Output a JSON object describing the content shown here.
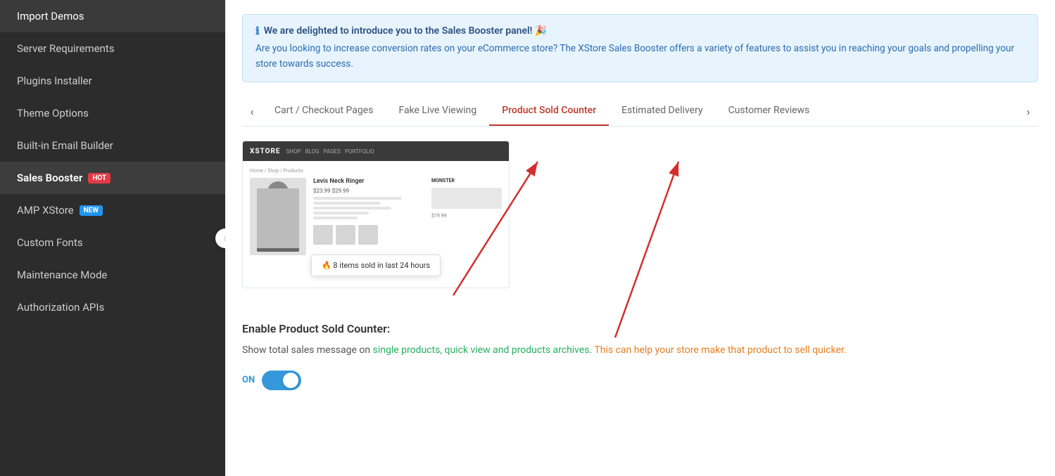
{
  "sidebar": {
    "items": [
      {
        "id": "import-demos",
        "label": "Import Demos",
        "active": false,
        "badge": null
      },
      {
        "id": "server-requirements",
        "label": "Server Requirements",
        "active": false,
        "badge": null
      },
      {
        "id": "plugins-installer",
        "label": "Plugins Installer",
        "active": false,
        "badge": null
      },
      {
        "id": "theme-options",
        "label": "Theme Options",
        "active": false,
        "badge": null
      },
      {
        "id": "built-in-email-builder",
        "label": "Built-in Email Builder",
        "active": false,
        "badge": null
      },
      {
        "id": "sales-booster",
        "label": "Sales Booster",
        "active": true,
        "badge": "HOT",
        "badge_type": "hot"
      },
      {
        "id": "amp-xstore",
        "label": "AMP XStore",
        "active": false,
        "badge": "NEW",
        "badge_type": "new"
      },
      {
        "id": "custom-fonts",
        "label": "Custom Fonts",
        "active": false,
        "badge": null
      },
      {
        "id": "maintenance-mode",
        "label": "Maintenance Mode",
        "active": false,
        "badge": null
      },
      {
        "id": "authorization-apis",
        "label": "Authorization APIs",
        "active": false,
        "badge": null
      }
    ]
  },
  "banner": {
    "icon": "ℹ",
    "title": "We are delighted to introduce you to the Sales Booster panel! 🎉",
    "description": "Are you looking to increase conversion rates on your eCommerce store? The XStore Sales Booster offers a variety of features to assist you in reaching your goals and propelling your store towards success."
  },
  "tabs": {
    "prev_arrow": "‹",
    "next_arrow": "›",
    "items": [
      {
        "id": "cart-checkout",
        "label": "Cart / Checkout Pages",
        "active": false
      },
      {
        "id": "fake-live-viewing",
        "label": "Fake Live Viewing",
        "active": false
      },
      {
        "id": "product-sold-counter",
        "label": "Product Sold Counter",
        "active": true
      },
      {
        "id": "estimated-delivery",
        "label": "Estimated Delivery",
        "active": false
      },
      {
        "id": "customer-reviews",
        "label": "Customer Reviews",
        "active": false
      }
    ]
  },
  "preview": {
    "logo": "XSTORE",
    "popup_text": "🔥 8 items sold in last 24 hours"
  },
  "content": {
    "enable_title": "Enable Product Sold Counter:",
    "enable_desc_part1": "Show total sales message on ",
    "enable_desc_green": "single products, quick view and products archives",
    "enable_desc_part2": ". ",
    "enable_desc_orange": "This can help your store make that product to sell quicker.",
    "toggle_label": "ON"
  }
}
